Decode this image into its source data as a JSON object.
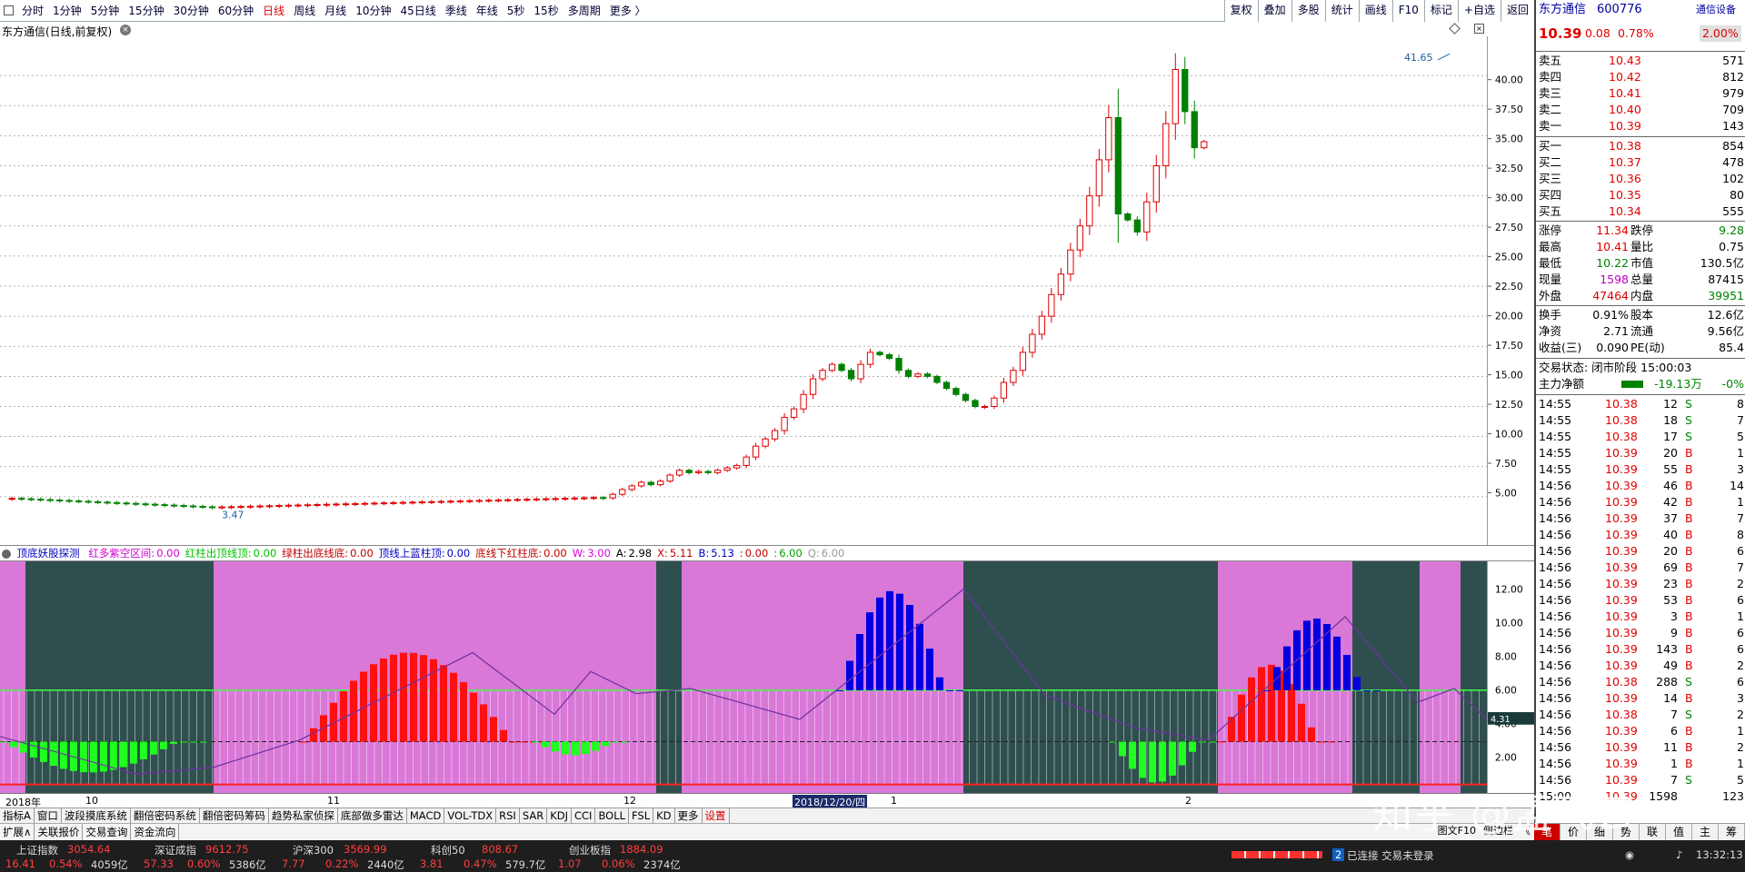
{
  "toolbar": {
    "periods": [
      "分时",
      "1分钟",
      "5分钟",
      "15分钟",
      "30分钟",
      "60分钟",
      "日线",
      "周线",
      "月线",
      "10分钟",
      "45日线",
      "季线",
      "年线",
      "5秒",
      "15秒",
      "多周期",
      "更多 〉"
    ],
    "active": "日线",
    "right_buttons": [
      "复权",
      "叠加",
      "多股",
      "统计",
      "画线",
      "F10",
      "标记",
      "+自选",
      "返回"
    ]
  },
  "chart": {
    "title": "东方通信(日线,前复权)",
    "high_label": "41.65",
    "low_label": "3.47",
    "y_ticks": [
      "40.00",
      "37.50",
      "35.00",
      "32.50",
      "30.00",
      "27.50",
      "25.00",
      "22.50",
      "20.00",
      "17.50",
      "15.00",
      "12.50",
      "10.00",
      "7.50",
      "5.00"
    ],
    "ylim": [
      2.5,
      42.5
    ]
  },
  "indicator": {
    "name": "顶底妖股探测",
    "items": [
      {
        "label": "红多紫空区间:",
        "value": "0.00",
        "color": "#d000d0"
      },
      {
        "label": "红柱出顶线顶:",
        "value": "0.00",
        "color": "#00c000"
      },
      {
        "label": "绿柱出底线底:",
        "value": "0.00",
        "color": "#c00000"
      },
      {
        "label": "顶线上蓝柱顶:",
        "value": "0.00",
        "color": "#0000c0"
      },
      {
        "label": "底线下红柱底:",
        "value": "0.00",
        "color": "#c00000"
      },
      {
        "label": "W:",
        "value": "3.00",
        "color": "#e000e0"
      },
      {
        "label": "A:",
        "value": "2.98",
        "color": "#000"
      },
      {
        "label": "X:",
        "value": "5.11",
        "color": "#c00000"
      },
      {
        "label": "B:",
        "value": "5.13",
        "color": "#0000c0"
      },
      {
        "label": ":",
        "value": "0.00",
        "color": "#c00000"
      },
      {
        "label": ":",
        "value": "6.00",
        "color": "#00a000"
      },
      {
        "label": "Q:",
        "value": "6.00",
        "color": "#999"
      }
    ],
    "y_ticks": [
      "12.00",
      "10.00",
      "8.00",
      "6.00",
      "4.00",
      "2.00"
    ],
    "current_value": "4.31"
  },
  "dates": {
    "labels": [
      "2018年",
      "10",
      "11",
      "12",
      "2018/12/20/四",
      "1",
      "2"
    ]
  },
  "tabs": [
    "指标A",
    "窗口",
    "波段摸底系统",
    "翻倍密码系统",
    "翻倍密码筹码",
    "趋势私家侦探",
    "底部做多雷达",
    "MACD",
    "VOL-TDX",
    "RSI",
    "SAR",
    "KDJ",
    "CCI",
    "BOLL",
    "FSL",
    "KD",
    "更多",
    "设置"
  ],
  "ext_tabs": [
    "扩展∧",
    "关联报价",
    "交易查询",
    "资金流向"
  ],
  "right_bottom": [
    "图文F10",
    "侧边栏",
    "《"
  ],
  "panel": {
    "stock": "东方通信",
    "code": "600776",
    "rating": "通信设备",
    "price": "10.39",
    "change": "0.08",
    "pct": "0.78%",
    "pct2": "2.00%",
    "asks": [
      [
        "卖五",
        "10.43",
        "571"
      ],
      [
        "卖四",
        "10.42",
        "812"
      ],
      [
        "卖三",
        "10.41",
        "979"
      ],
      [
        "卖二",
        "10.40",
        "709"
      ],
      [
        "卖一",
        "10.39",
        "143"
      ]
    ],
    "bids": [
      [
        "买一",
        "10.38",
        "854"
      ],
      [
        "买二",
        "10.37",
        "478"
      ],
      [
        "买三",
        "10.36",
        "102"
      ],
      [
        "买四",
        "10.35",
        "80"
      ],
      [
        "买五",
        "10.34",
        "555"
      ]
    ],
    "stats": [
      [
        "涨停",
        "11.34",
        "跌停",
        "9.28"
      ],
      [
        "最高",
        "10.41",
        "量比",
        "0.75"
      ],
      [
        "最低",
        "10.22",
        "市值",
        "130.5亿"
      ],
      [
        "现量",
        "1598",
        "总量",
        "87415"
      ],
      [
        "外盘",
        "47464",
        "内盘",
        "39951"
      ]
    ],
    "stats2": [
      [
        "换手",
        "0.91%",
        "股本",
        "12.6亿"
      ],
      [
        "净资",
        "2.71",
        "流通",
        "9.56亿"
      ],
      [
        "收益(三)",
        "0.090",
        "PE(动)",
        "85.4"
      ]
    ],
    "trade_state": "交易状态: 闭市阶段 15:00:03",
    "main_flow_label": "主力净额",
    "main_flow_value": "-19.13万",
    "main_flow_pct": "-0%",
    "ticks": [
      [
        "14:55",
        "10.38",
        "12",
        "S",
        "8"
      ],
      [
        "14:55",
        "10.38",
        "18",
        "S",
        "7"
      ],
      [
        "14:55",
        "10.38",
        "17",
        "S",
        "5"
      ],
      [
        "14:55",
        "10.39",
        "20",
        "B",
        "1"
      ],
      [
        "14:55",
        "10.39",
        "55",
        "B",
        "3"
      ],
      [
        "14:56",
        "10.39",
        "46",
        "B",
        "14"
      ],
      [
        "14:56",
        "10.39",
        "42",
        "B",
        "1"
      ],
      [
        "14:56",
        "10.39",
        "37",
        "B",
        "7"
      ],
      [
        "14:56",
        "10.39",
        "40",
        "B",
        "8"
      ],
      [
        "14:56",
        "10.39",
        "20",
        "B",
        "6"
      ],
      [
        "14:56",
        "10.39",
        "69",
        "B",
        "7"
      ],
      [
        "14:56",
        "10.39",
        "23",
        "B",
        "2"
      ],
      [
        "14:56",
        "10.39",
        "53",
        "B",
        "6"
      ],
      [
        "14:56",
        "10.39",
        "3",
        "B",
        "1"
      ],
      [
        "14:56",
        "10.39",
        "9",
        "B",
        "6"
      ],
      [
        "14:56",
        "10.39",
        "143",
        "B",
        "6"
      ],
      [
        "14:56",
        "10.39",
        "49",
        "B",
        "2"
      ],
      [
        "14:56",
        "10.38",
        "288",
        "S",
        "6"
      ],
      [
        "14:56",
        "10.39",
        "14",
        "B",
        "3"
      ],
      [
        "14:56",
        "10.38",
        "7",
        "S",
        "2"
      ],
      [
        "14:56",
        "10.39",
        "6",
        "B",
        "1"
      ],
      [
        "14:56",
        "10.39",
        "11",
        "B",
        "2"
      ],
      [
        "14:56",
        "10.39",
        "1",
        "B",
        "1"
      ],
      [
        "14:56",
        "10.39",
        "7",
        "S",
        "5"
      ],
      [
        "15:00",
        "10.39",
        "1598",
        "",
        "123"
      ]
    ],
    "tabs": [
      "笔",
      "价",
      "细",
      "势",
      "联",
      "值",
      "主",
      "筹"
    ]
  },
  "status": {
    "indices": [
      {
        "name": "上证指数",
        "value": "3054.64",
        "chg": "16.41",
        "pct": "0.54%",
        "amt": "4059亿"
      },
      {
        "name": "深证成指",
        "value": "9612.75",
        "chg": "57.33",
        "pct": "0.60%",
        "amt": "5386亿"
      },
      {
        "name": "沪深300",
        "value": "3569.99",
        "chg": "7.77",
        "pct": "0.22%",
        "amt": "2440亿"
      },
      {
        "name": "科创50",
        "value": "808.67",
        "chg": "3.81",
        "pct": "0.47%",
        "amt": "579.7亿"
      },
      {
        "name": "创业板指",
        "value": "1884.09",
        "chg": "1.07",
        "pct": "0.06%",
        "amt": "2374亿"
      }
    ],
    "connection": "已连接 交易未登录",
    "conn_num": "2",
    "time": "13:32:13"
  },
  "watermark": "知乎 @孟飞云"
}
